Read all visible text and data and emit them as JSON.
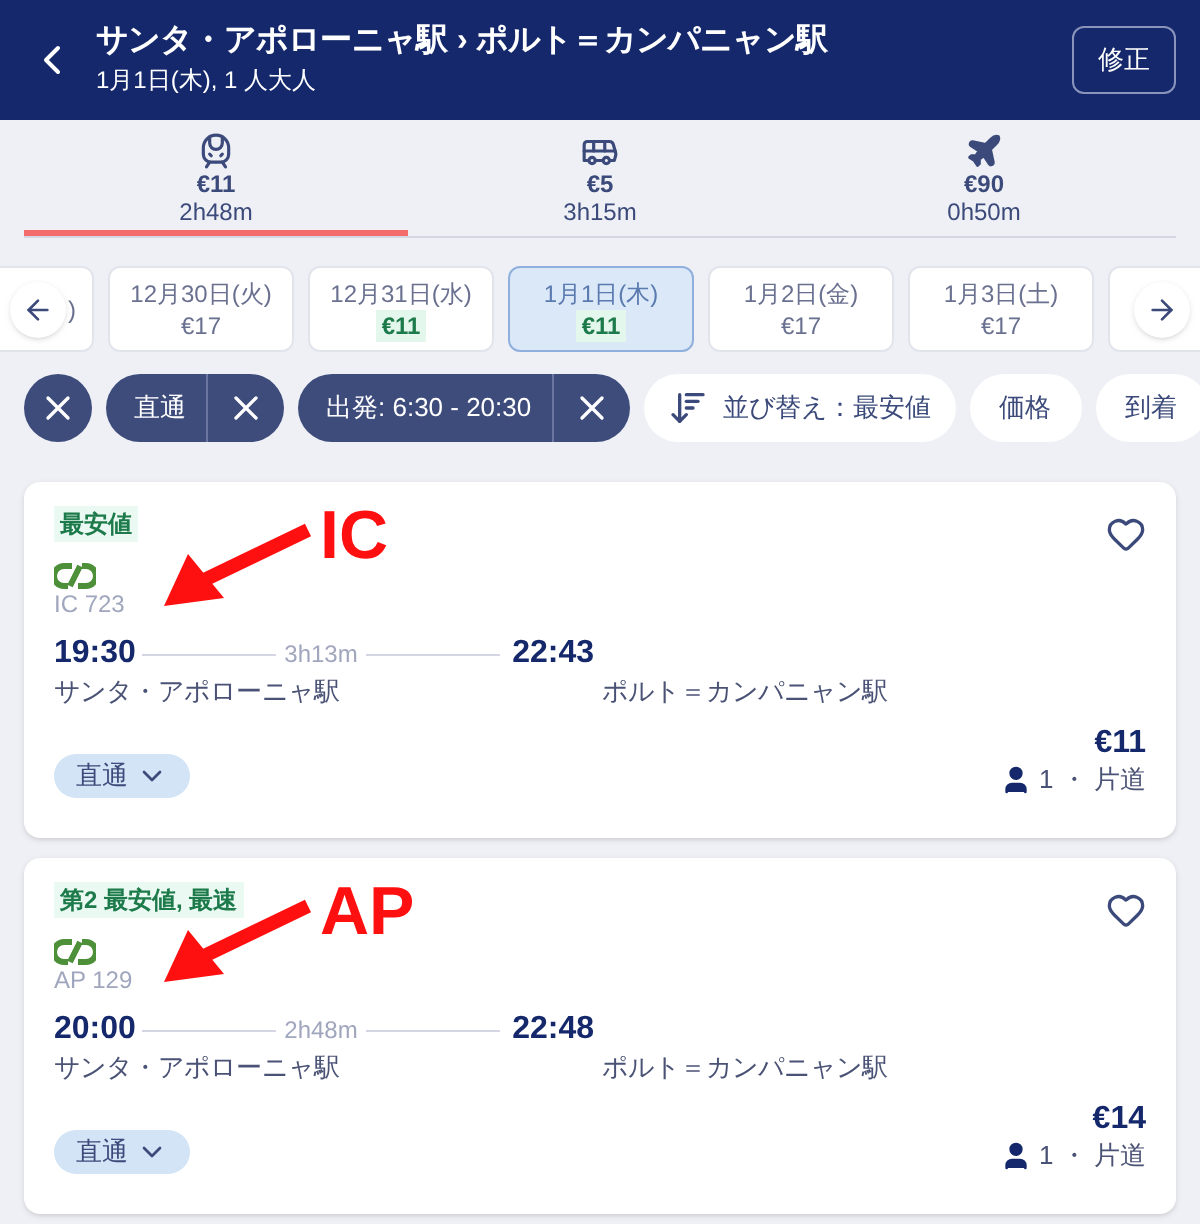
{
  "header": {
    "title": "サンタ・アポローニャ駅 › ポルト＝カンパニャン駅",
    "subtitle": "1月1日(木), 1 人大人",
    "edit_button": "修正"
  },
  "modes": [
    {
      "kind": "train",
      "price": "€11",
      "duration": "2h48m",
      "selected": true
    },
    {
      "kind": "bus",
      "price": "€5",
      "duration": "3h15m",
      "selected": false
    },
    {
      "kind": "plane",
      "price": "€90",
      "duration": "0h50m",
      "selected": false
    }
  ],
  "dates": [
    {
      "label": ")",
      "selected": false
    },
    {
      "label": "12月30日(火)",
      "price": "€17",
      "selected": false,
      "cheapest": false
    },
    {
      "label": "12月31日(水)",
      "price": "€11",
      "selected": false,
      "cheapest": true
    },
    {
      "label": "1月1日(木)",
      "price": "€11",
      "selected": true,
      "cheapest": true
    },
    {
      "label": "1月2日(金)",
      "price": "€17",
      "selected": false,
      "cheapest": false
    },
    {
      "label": "1月3日(土)",
      "price": "€17",
      "selected": false,
      "cheapest": false
    }
  ],
  "filters": [
    {
      "kind": "clear"
    },
    {
      "kind": "active",
      "label": "直通"
    },
    {
      "kind": "active",
      "label": "出発: 6:30 - 20:30"
    },
    {
      "kind": "sort",
      "label": "並び替え：最安値"
    },
    {
      "kind": "plain",
      "label": "価格"
    },
    {
      "kind": "plain",
      "label": "到着"
    }
  ],
  "results": [
    {
      "tag": "最安値",
      "train": "IC 723",
      "depart": "19:30",
      "duration": "3h13m",
      "arrive": "22:43",
      "from": "サンタ・アポローニャ駅",
      "to": "ポルト＝カンパニャン駅",
      "stops": "直通",
      "price": "€11",
      "passengers": "1 ・ 片道",
      "favorite": false,
      "annotation": "IC"
    },
    {
      "tag": "第2 最安値, 最速",
      "train": "AP 129",
      "depart": "20:00",
      "duration": "2h48m",
      "arrive": "22:48",
      "from": "サンタ・アポローニャ駅",
      "to": "ポルト＝カンパニャン駅",
      "stops": "直通",
      "price": "€14",
      "passengers": "1 ・ 片道",
      "favorite": false,
      "annotation": "AP"
    }
  ]
}
